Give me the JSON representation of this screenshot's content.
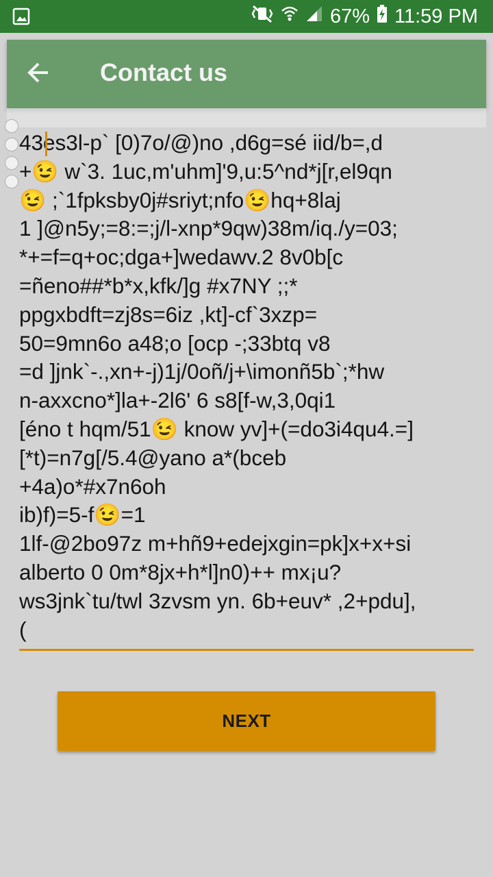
{
  "status_bar": {
    "battery": "67%",
    "time": "11:59 PM",
    "icons": [
      "image-icon",
      "mute-vibrate-icon",
      "wifi-icon",
      "signal-icon",
      "battery-charging-icon"
    ]
  },
  "appbar": {
    "title": "Contact us",
    "back_icon": "arrow-back-icon"
  },
  "message": {
    "lines": [
      "43es3l-p` [0)7o/@)no ,d6g=sé iid/b=,d",
      "+😉 w`3. 1uc,m'uhm]'9,u:5^nd*j[r,el9qn",
      "😉 ;`1fpksby0j#sriyt;nfo😉hq+8laj",
      "1 ]@n5y;=8:=;j/l-xnp*9qw)38m/iq./y=03;",
      "*+=f=q+oc;dga+]wedawv.2 8v0b[c",
      "=ñeno##*b*x,kfk/]g #x7NY ;;*",
      "ppgxbdft=zj8s=6iz ,kt]-cf`3xzp=",
      "50=9mn6o a48;o [ocp -;33btq v8",
      "=d ]jnk`-.,xn+-j)1j/0oñ/j+\\imonñ5b`;*hw",
      "n-axxcno*]la+-2l6' 6 s8[f-w,3,0qi1",
      "[éno t hqm/51😉 know yv]+(=do3i4qu4.=]",
      "[*t)=n7g[/5.4@yano a*(bceb",
      "+4a)o*#x7n6oh",
      "ib)f)=5-f😉=1",
      "1lf-@2bo97z m+hñ9+edejxgin=pk]x+x+si",
      "alberto 0 0m*8jx+h*l]n0)++ mx¡u?",
      "ws3jnk`tu/twl 3zvsm yn. 6b+euv* ,2+pdu],",
      "("
    ]
  },
  "next_button": {
    "label": "NEXT"
  },
  "colors": {
    "status_bar": "#2e7d32",
    "appbar": "#6a9c6b",
    "accent": "#d48d00",
    "background": "#d3d3d3"
  }
}
